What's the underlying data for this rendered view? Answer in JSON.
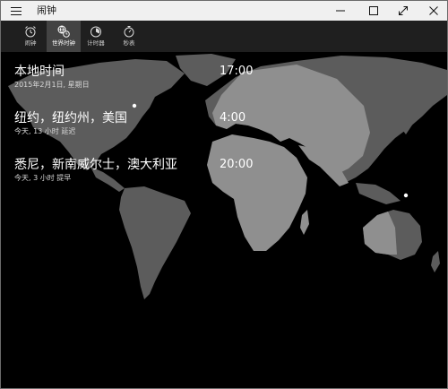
{
  "app": {
    "title": "闹钟"
  },
  "tabs": [
    {
      "label": "闹钟",
      "icon": "alarm-clock-icon"
    },
    {
      "label": "世界时钟",
      "icon": "world-clock-icon"
    },
    {
      "label": "计时器",
      "icon": "timer-icon"
    },
    {
      "label": "秒表",
      "icon": "stopwatch-icon"
    }
  ],
  "active_tab": 1,
  "clocks": [
    {
      "name": "本地时间",
      "subtitle": "2015年2月1日, 星期日",
      "time": "17:00"
    },
    {
      "name": "纽约，纽约州，美国",
      "subtitle": "今天, 13 小时 延迟",
      "time": "4:00"
    },
    {
      "name": "悉尼，新南威尔士，澳大利亚",
      "subtitle": "今天, 3 小时 提早",
      "time": "20:00"
    }
  ],
  "colors": {
    "land": "#5c5c5c",
    "daylight_land": "#8f8f8f",
    "ocean": "#000000",
    "tab_bar": "#1f1f1f",
    "tab_active": "#434343"
  }
}
